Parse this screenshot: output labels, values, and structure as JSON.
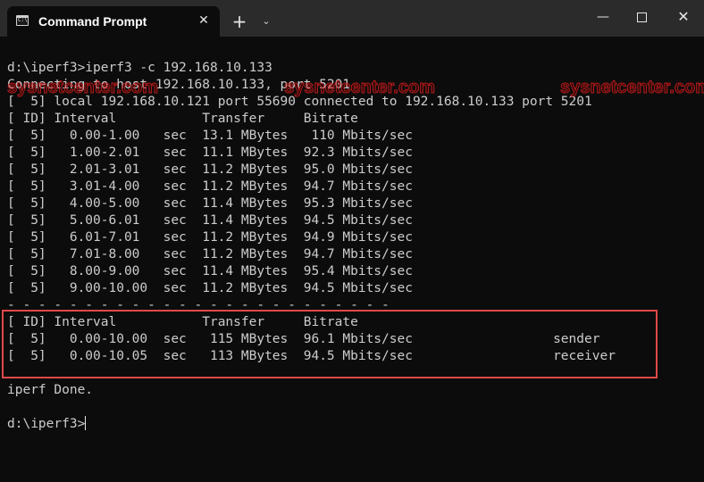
{
  "window": {
    "tab_title": "Command Prompt",
    "tab_icon_text": "C:\\",
    "tab_close_glyph": "✕",
    "new_tab_glyph": "+",
    "dropdown_glyph": "⌄",
    "minimize_glyph": "—",
    "close_glyph": "✕"
  },
  "terminal": {
    "lines": [
      "d:\\iperf3>iperf3 -c 192.168.10.133",
      "Connecting to host 192.168.10.133, port 5201",
      "[  5] local 192.168.10.121 port 55690 connected to 192.168.10.133 port 5201",
      "[ ID] Interval           Transfer     Bitrate",
      "[  5]   0.00-1.00   sec  13.1 MBytes   110 Mbits/sec",
      "[  5]   1.00-2.01   sec  11.1 MBytes  92.3 Mbits/sec",
      "[  5]   2.01-3.01   sec  11.2 MBytes  95.0 Mbits/sec",
      "[  5]   3.01-4.00   sec  11.2 MBytes  94.7 Mbits/sec",
      "[  5]   4.00-5.00   sec  11.4 MBytes  95.3 Mbits/sec",
      "[  5]   5.00-6.01   sec  11.4 MBytes  94.5 Mbits/sec",
      "[  5]   6.01-7.01   sec  11.2 MBytes  94.9 Mbits/sec",
      "[  5]   7.01-8.00   sec  11.2 MBytes  94.7 Mbits/sec",
      "[  5]   8.00-9.00   sec  11.4 MBytes  95.4 Mbits/sec",
      "[  5]   9.00-10.00  sec  11.2 MBytes  94.5 Mbits/sec",
      "- - - - - - - - - - - - - - - - - - - - - - - - -",
      "[ ID] Interval           Transfer     Bitrate",
      "[  5]   0.00-10.00  sec   115 MBytes  96.1 Mbits/sec                  sender",
      "[  5]   0.00-10.05  sec   113 MBytes  94.5 Mbits/sec                  receiver",
      "",
      "iperf Done.",
      "",
      "d:\\iperf3>"
    ],
    "watermarks": [
      "sysnetcenter.com",
      "sysnetcenter.com",
      "sysnetcenter.com"
    ],
    "colors": {
      "background": "#0c0c0c",
      "text": "#cccccc",
      "highlight_box": "#e04848",
      "watermark": "#c81010",
      "titlebar": "#2b2b2b"
    }
  }
}
